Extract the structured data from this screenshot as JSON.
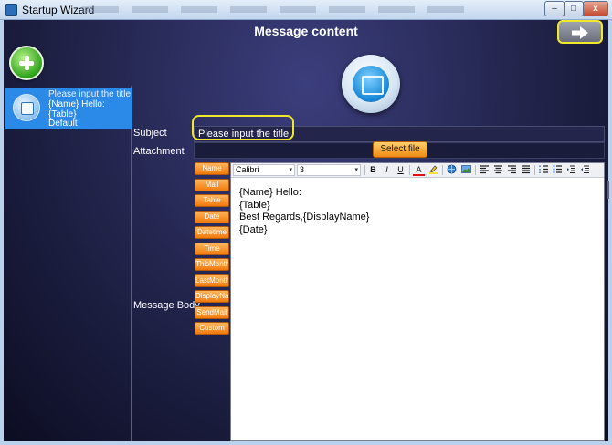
{
  "window": {
    "title": "Startup Wizard",
    "min_label": "–",
    "max_label": "□",
    "close_label": "x"
  },
  "header": {
    "title": "Message content"
  },
  "sidebar": {
    "item": {
      "title": "Please input the title",
      "line2": "{Name} Hello:",
      "line3": "{Table}",
      "status": "Default"
    }
  },
  "form": {
    "subject_label": "Subject",
    "subject_value": "Please input the title",
    "attachment_label": "Attachment",
    "select_file_label": "Select file",
    "message_body_label": "Message Body"
  },
  "field_buttons": [
    "Name",
    "Mail",
    "Table",
    "Date",
    "Datetime",
    "Time",
    "ThisMonth",
    "LastMonth",
    "DisplayName",
    "SendMail",
    "Custom"
  ],
  "toolbar": {
    "font": "Calibri",
    "size": "3",
    "bold": "B",
    "italic": "I",
    "underline": "U",
    "font_color": "A"
  },
  "editor": {
    "lines": [
      "{Name} Hello:",
      "{Table}",
      "Best Regards,{DisplayName}",
      "{Date}"
    ]
  },
  "colors": {
    "highlight": "#f0e82a",
    "accent_orange": "#f07a0c",
    "selected_item": "#2b8ae8"
  }
}
